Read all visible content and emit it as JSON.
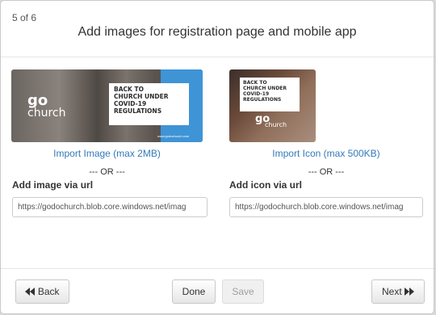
{
  "dialog": {
    "step": "5 of 6",
    "title": "Add images for registration page and mobile app"
  },
  "image": {
    "import_label": "Import Image (max 2MB)",
    "or_label": "--- OR ---",
    "url_label": "Add image via url",
    "url_value": "https://godochurch.blob.core.windows.net/imag",
    "preview": {
      "lines": [
        "BACK TO",
        "CHURCH UNDER",
        "COVID-19",
        "REGULATIONS"
      ],
      "logo_top": "go",
      "logo_bottom": "church",
      "site": "www.godochurch.com"
    }
  },
  "icon": {
    "import_label": "Import Icon (max 500KB)",
    "or_label": "--- OR ---",
    "url_label": "Add icon via url",
    "url_value": "https://godochurch.blob.core.windows.net/imag",
    "preview": {
      "lines": [
        "BACK TO",
        "CHURCH UNDER",
        "COVID-19",
        "REGULATIONS"
      ],
      "logo_top": "go",
      "logo_bottom": "church"
    }
  },
  "footer": {
    "back_label": "Back",
    "done_label": "Done",
    "save_label": "Save",
    "next_label": "Next"
  },
  "colors": {
    "link": "#337ab7",
    "banner_blue": "#3f94d6"
  }
}
